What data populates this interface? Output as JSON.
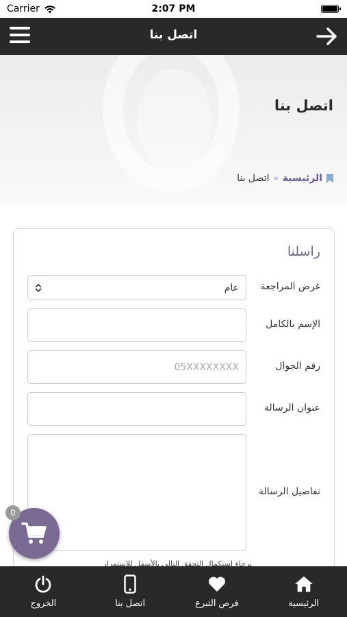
{
  "status_bar": {
    "carrier": "Carrier",
    "time": "2:07 PM"
  },
  "header": {
    "title": "اتصل بنا"
  },
  "hero": {
    "title": "اتصل بنا",
    "breadcrumb": {
      "home": "الرئيسية",
      "separator": "»",
      "current": "اتصل بنا"
    }
  },
  "form": {
    "title": "راسلنا",
    "purpose_label": "غرض المراجعة",
    "purpose_value": "عام",
    "fullname_label": "الإسم بالكامل",
    "fullname_value": "",
    "mobile_label": "رقم الجوال",
    "mobile_placeholder": "05XXXXXXXX",
    "subject_label": "عنوان الرسالة",
    "subject_value": "",
    "details_label": "تفاصيل الرسالة",
    "details_value": "",
    "note": "يرجاء استكمال التحقق التالي بالأسفل للاستمرار"
  },
  "cart": {
    "count": "0"
  },
  "tabbar": {
    "items": [
      {
        "label": "الرئيسية",
        "icon": "home-icon"
      },
      {
        "label": "فرص التبرع",
        "icon": "heart-icon"
      },
      {
        "label": "اتصل بنا",
        "icon": "mobile-phone-icon"
      },
      {
        "label": "الخروج",
        "icon": "power-icon"
      }
    ]
  },
  "colors": {
    "nav_bg": "#2b282c",
    "accent": "#7a6a94",
    "breadcrumb_home": "#6b5b8e"
  }
}
